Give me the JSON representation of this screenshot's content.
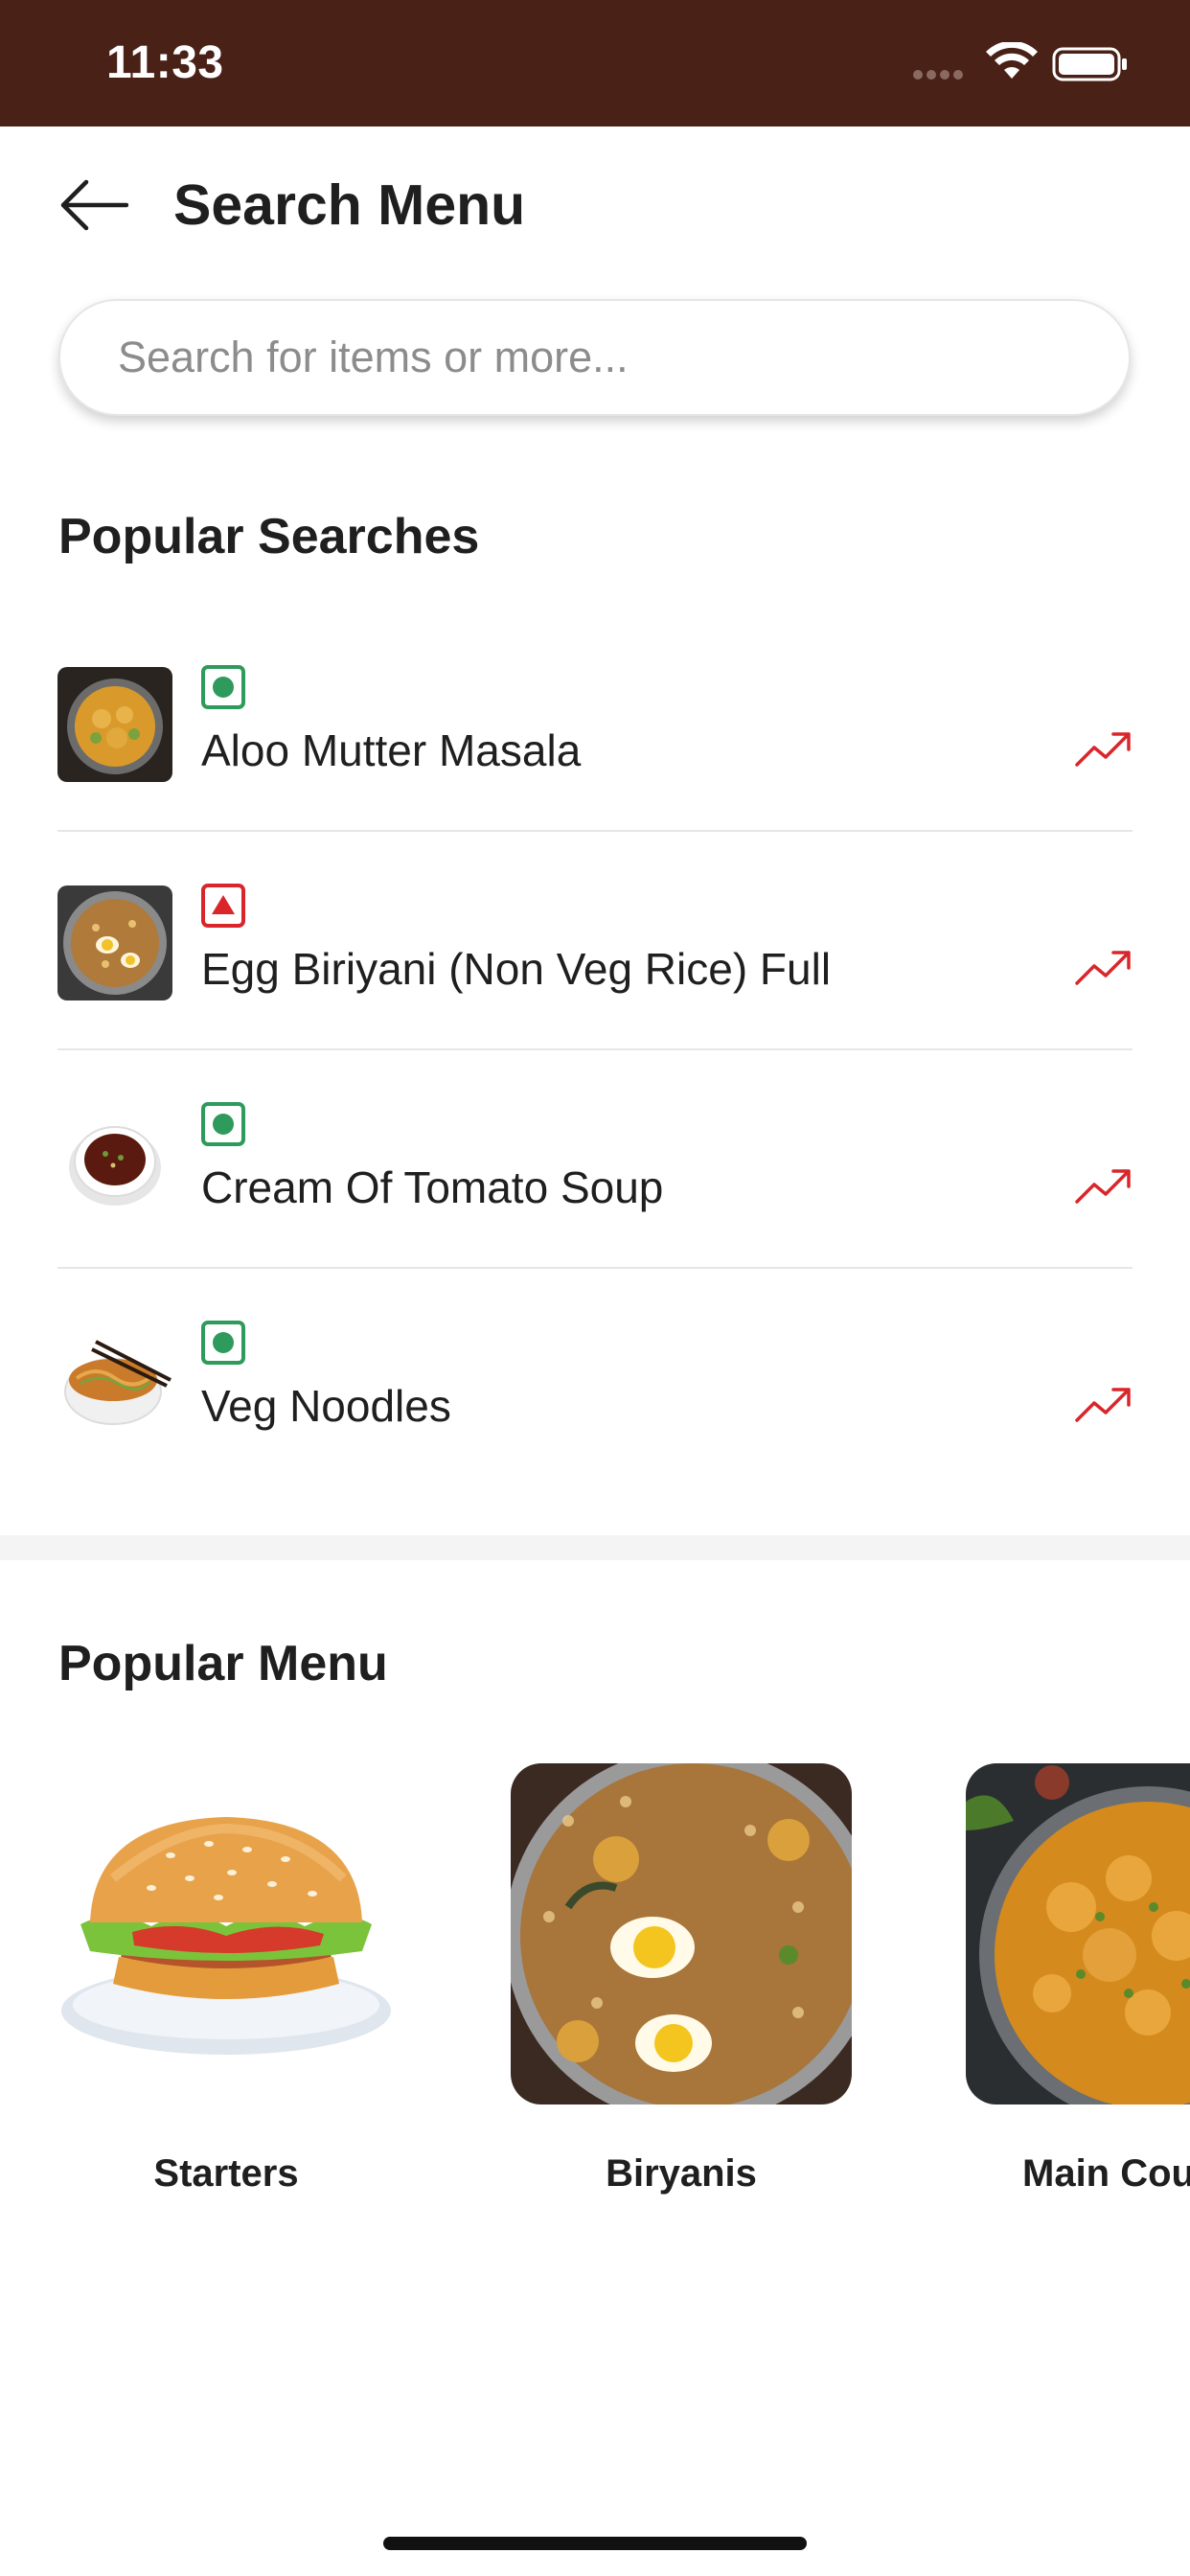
{
  "status_bar": {
    "time": "11:33",
    "background": "#4a2117",
    "signal_icon": "cellular-signal-icon",
    "wifi_icon": "wifi-icon",
    "battery_icon": "battery-icon"
  },
  "header": {
    "back_icon": "arrow-left-icon",
    "title": "Search Menu"
  },
  "search": {
    "placeholder": "Search for items or more...",
    "value": ""
  },
  "popular_searches": {
    "title": "Popular Searches",
    "items": [
      {
        "label": "Aloo Mutter Masala",
        "diet": "veg",
        "trend_icon": "trending-up-icon"
      },
      {
        "label": "Egg Biriyani (Non Veg Rice) Full",
        "diet": "non-veg",
        "trend_icon": "trending-up-icon"
      },
      {
        "label": "Cream Of Tomato Soup",
        "diet": "veg",
        "trend_icon": "trending-up-icon"
      },
      {
        "label": "Veg Noodles",
        "diet": "veg",
        "trend_icon": "trending-up-icon"
      }
    ]
  },
  "popular_menu": {
    "title": "Popular Menu",
    "items": [
      {
        "label": "Starters"
      },
      {
        "label": "Biryanis"
      },
      {
        "label": "Main Cou"
      }
    ]
  },
  "colors": {
    "veg": "#2e9a5c",
    "non_veg": "#d9262b",
    "trend": "#d9262b"
  }
}
